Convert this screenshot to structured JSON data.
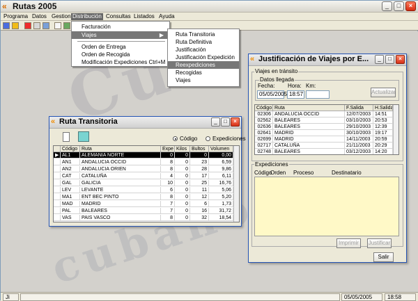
{
  "app": {
    "title": "Rutas 2005",
    "icon": "rutas-app-icon"
  },
  "menu": [
    "Programa",
    "Datos",
    "Gestion",
    "Distribución",
    "Consultas",
    "Listados",
    "Ayuda"
  ],
  "distribucion_menu": [
    "Facturación",
    "Viajes",
    "Orden de Entrega",
    "Orden de Recogida",
    "Modificación Expediciones  Ctrl+M"
  ],
  "viajes_menu": [
    "Ruta Transitoria",
    "Ruta Definitiva",
    "Justificación",
    "Justificación Expedición",
    "Reexpediciones",
    "Recogidas",
    "Viajes"
  ],
  "status": {
    "left": "Ji",
    "date": "05/05/2005",
    "time": "18:58"
  },
  "ruta": {
    "title": "Ruta Transitoria",
    "radio_codigo": "Código",
    "radio_expediciones": "Expediciones",
    "headers": [
      "Código",
      "Ruta",
      "Expe",
      "Kilos",
      "Bultos",
      "Volumen"
    ],
    "rows": [
      [
        "AL1",
        "ALEMANIA NORTE",
        "0",
        "0",
        "0",
        "0,00"
      ],
      [
        "AN1",
        "ANDALUCIA OCCID",
        "8",
        "0",
        "23",
        "6,59"
      ],
      [
        "AN2",
        "ANDALUCIA ORIEN",
        "8",
        "0",
        "28",
        "9,86"
      ],
      [
        "CAT",
        "CATALUÑA",
        "4",
        "0",
        "17",
        "6,11"
      ],
      [
        "GAL",
        "GALICIA",
        "10",
        "0",
        "25",
        "16,76"
      ],
      [
        "LEV",
        "LEVANTE",
        "6",
        "0",
        "11",
        "5,06"
      ],
      [
        "MA1",
        "ENT BEC PINTO",
        "8",
        "0",
        "12",
        "5,20"
      ],
      [
        "MAD",
        "MADRID",
        "7",
        "0",
        "6",
        "1,73"
      ],
      [
        "PAL",
        "BALEARES",
        "7",
        "0",
        "16",
        "31,72"
      ],
      [
        "VAS",
        "PAIS VASCO",
        "8",
        "0",
        "32",
        "18,54"
      ]
    ]
  },
  "just": {
    "title": "Justificación de Viajes por E...",
    "transit": "Viajes en tránsito",
    "arrival": "Datos llegada",
    "fecha_label": "Fecha:",
    "hora_label": "Hora:",
    "km_label": "Km:",
    "fecha": "05/05/2005",
    "hora": "18:57",
    "km": "",
    "update": "Actualizar",
    "headers": [
      "Código",
      "Ruta",
      "F.Salida",
      "H.Salida"
    ],
    "rows": [
      [
        "02306",
        "ANDALUCIA OCCID",
        "12/07/2003",
        "14:51"
      ],
      [
        "02562",
        "BALEARES",
        "03/10/2003",
        "20:53"
      ],
      [
        "02636",
        "BALEARES",
        "29/10/2003",
        "12:39"
      ],
      [
        "02641",
        "MADRID",
        "30/10/2003",
        "19:17"
      ],
      [
        "02699",
        "MADRID",
        "14/11/2003",
        "20:59"
      ],
      [
        "02717",
        "CATALUÑA",
        "21/11/2003",
        "20:29"
      ],
      [
        "02748",
        "BALEARES",
        "03/12/2003",
        "14:20"
      ]
    ],
    "expediciones": "Expediciones",
    "exp_headers": [
      "Código",
      "Orden",
      "Proceso",
      "Destinatario"
    ],
    "imprimir": "Imprimir",
    "justificar": "Justificar",
    "salir": "Salir"
  }
}
